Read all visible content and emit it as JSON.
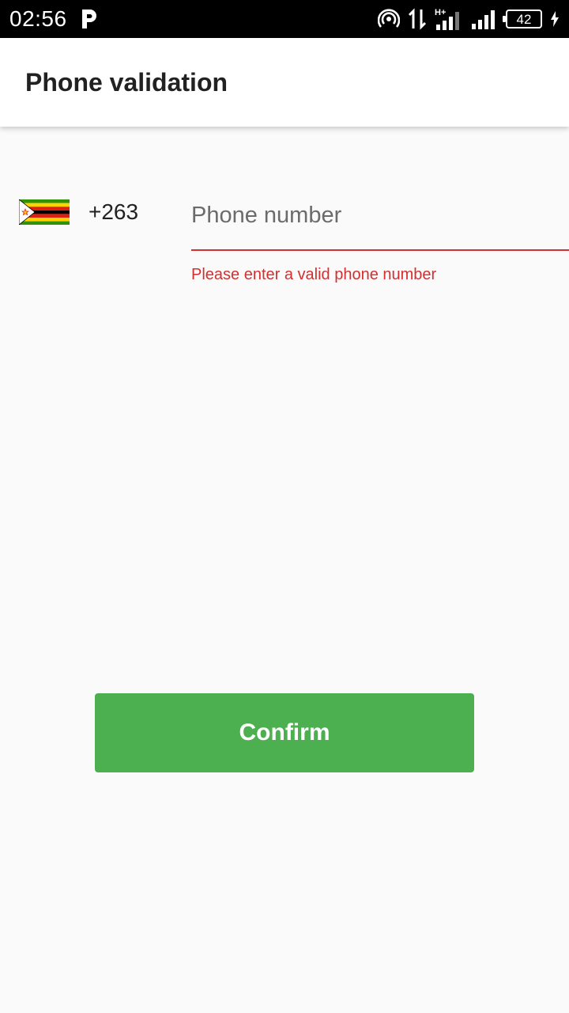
{
  "status_bar": {
    "time": "02:56",
    "battery_level": "42",
    "network_type": "H+",
    "icons": [
      "parking-p-icon",
      "hotspot-icon",
      "data-transfer-icon",
      "signal-icon-sim1",
      "signal-icon-sim2",
      "battery-icon",
      "charging-bolt-icon"
    ]
  },
  "app_bar": {
    "title": "Phone validation"
  },
  "phone_form": {
    "country_flag": "zimbabwe-flag-icon",
    "dial_code": "+263",
    "phone_value": "",
    "phone_placeholder": "Phone number",
    "error_message": "Please enter a valid phone number"
  },
  "confirm": {
    "label": "Confirm"
  },
  "colors": {
    "error": "#d32f2f",
    "button": "#4caf50",
    "background": "#fafafa"
  }
}
